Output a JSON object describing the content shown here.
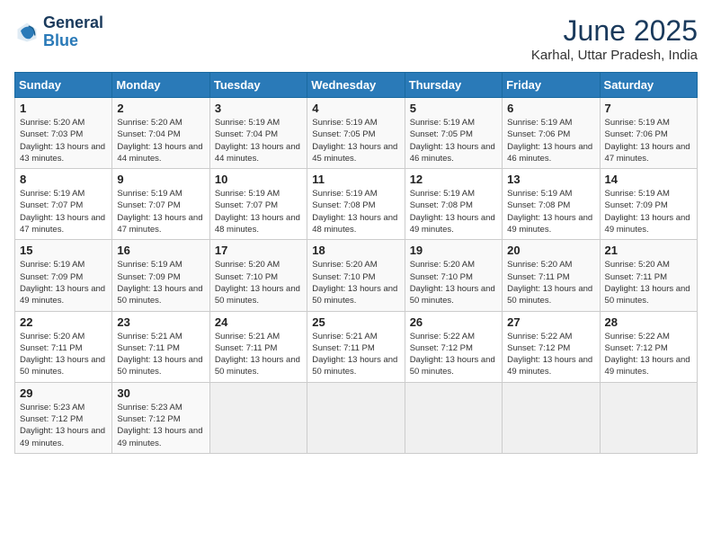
{
  "logo": {
    "line1": "General",
    "line2": "Blue"
  },
  "header": {
    "month": "June 2025",
    "location": "Karhal, Uttar Pradesh, India"
  },
  "weekdays": [
    "Sunday",
    "Monday",
    "Tuesday",
    "Wednesday",
    "Thursday",
    "Friday",
    "Saturday"
  ],
  "weeks": [
    [
      {
        "day": "1",
        "sunrise": "5:20 AM",
        "sunset": "7:03 PM",
        "daylight": "13 hours and 43 minutes."
      },
      {
        "day": "2",
        "sunrise": "5:20 AM",
        "sunset": "7:04 PM",
        "daylight": "13 hours and 44 minutes."
      },
      {
        "day": "3",
        "sunrise": "5:19 AM",
        "sunset": "7:04 PM",
        "daylight": "13 hours and 44 minutes."
      },
      {
        "day": "4",
        "sunrise": "5:19 AM",
        "sunset": "7:05 PM",
        "daylight": "13 hours and 45 minutes."
      },
      {
        "day": "5",
        "sunrise": "5:19 AM",
        "sunset": "7:05 PM",
        "daylight": "13 hours and 46 minutes."
      },
      {
        "day": "6",
        "sunrise": "5:19 AM",
        "sunset": "7:06 PM",
        "daylight": "13 hours and 46 minutes."
      },
      {
        "day": "7",
        "sunrise": "5:19 AM",
        "sunset": "7:06 PM",
        "daylight": "13 hours and 47 minutes."
      }
    ],
    [
      {
        "day": "8",
        "sunrise": "5:19 AM",
        "sunset": "7:07 PM",
        "daylight": "13 hours and 47 minutes."
      },
      {
        "day": "9",
        "sunrise": "5:19 AM",
        "sunset": "7:07 PM",
        "daylight": "13 hours and 47 minutes."
      },
      {
        "day": "10",
        "sunrise": "5:19 AM",
        "sunset": "7:07 PM",
        "daylight": "13 hours and 48 minutes."
      },
      {
        "day": "11",
        "sunrise": "5:19 AM",
        "sunset": "7:08 PM",
        "daylight": "13 hours and 48 minutes."
      },
      {
        "day": "12",
        "sunrise": "5:19 AM",
        "sunset": "7:08 PM",
        "daylight": "13 hours and 49 minutes."
      },
      {
        "day": "13",
        "sunrise": "5:19 AM",
        "sunset": "7:08 PM",
        "daylight": "13 hours and 49 minutes."
      },
      {
        "day": "14",
        "sunrise": "5:19 AM",
        "sunset": "7:09 PM",
        "daylight": "13 hours and 49 minutes."
      }
    ],
    [
      {
        "day": "15",
        "sunrise": "5:19 AM",
        "sunset": "7:09 PM",
        "daylight": "13 hours and 49 minutes."
      },
      {
        "day": "16",
        "sunrise": "5:19 AM",
        "sunset": "7:09 PM",
        "daylight": "13 hours and 50 minutes."
      },
      {
        "day": "17",
        "sunrise": "5:20 AM",
        "sunset": "7:10 PM",
        "daylight": "13 hours and 50 minutes."
      },
      {
        "day": "18",
        "sunrise": "5:20 AM",
        "sunset": "7:10 PM",
        "daylight": "13 hours and 50 minutes."
      },
      {
        "day": "19",
        "sunrise": "5:20 AM",
        "sunset": "7:10 PM",
        "daylight": "13 hours and 50 minutes."
      },
      {
        "day": "20",
        "sunrise": "5:20 AM",
        "sunset": "7:11 PM",
        "daylight": "13 hours and 50 minutes."
      },
      {
        "day": "21",
        "sunrise": "5:20 AM",
        "sunset": "7:11 PM",
        "daylight": "13 hours and 50 minutes."
      }
    ],
    [
      {
        "day": "22",
        "sunrise": "5:20 AM",
        "sunset": "7:11 PM",
        "daylight": "13 hours and 50 minutes."
      },
      {
        "day": "23",
        "sunrise": "5:21 AM",
        "sunset": "7:11 PM",
        "daylight": "13 hours and 50 minutes."
      },
      {
        "day": "24",
        "sunrise": "5:21 AM",
        "sunset": "7:11 PM",
        "daylight": "13 hours and 50 minutes."
      },
      {
        "day": "25",
        "sunrise": "5:21 AM",
        "sunset": "7:11 PM",
        "daylight": "13 hours and 50 minutes."
      },
      {
        "day": "26",
        "sunrise": "5:22 AM",
        "sunset": "7:12 PM",
        "daylight": "13 hours and 50 minutes."
      },
      {
        "day": "27",
        "sunrise": "5:22 AM",
        "sunset": "7:12 PM",
        "daylight": "13 hours and 49 minutes."
      },
      {
        "day": "28",
        "sunrise": "5:22 AM",
        "sunset": "7:12 PM",
        "daylight": "13 hours and 49 minutes."
      }
    ],
    [
      {
        "day": "29",
        "sunrise": "5:23 AM",
        "sunset": "7:12 PM",
        "daylight": "13 hours and 49 minutes."
      },
      {
        "day": "30",
        "sunrise": "5:23 AM",
        "sunset": "7:12 PM",
        "daylight": "13 hours and 49 minutes."
      },
      null,
      null,
      null,
      null,
      null
    ]
  ]
}
